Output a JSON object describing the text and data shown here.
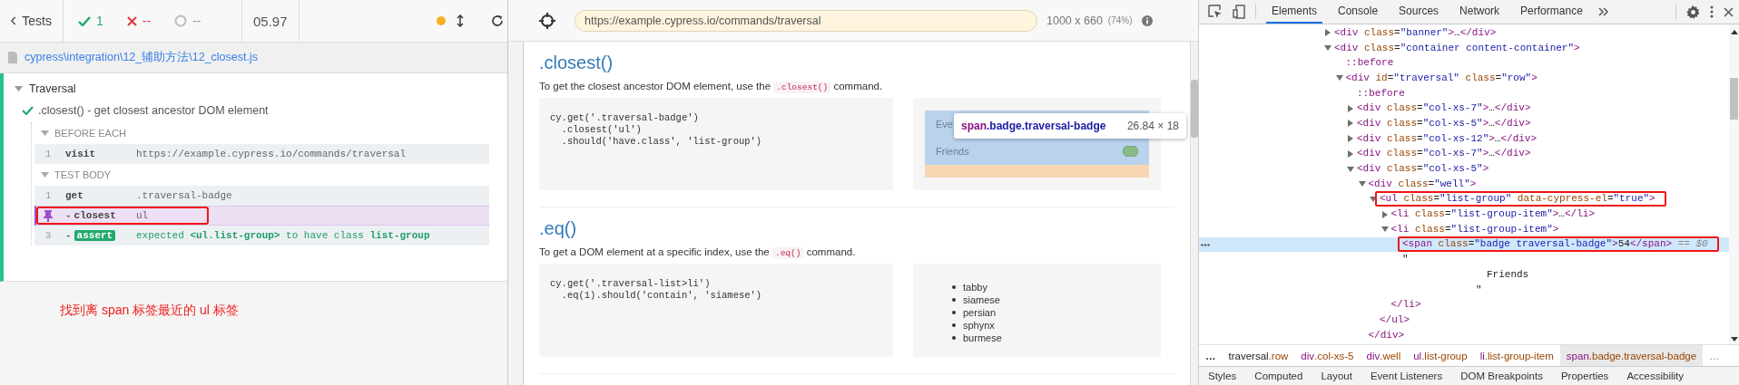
{
  "runner": {
    "back_button": "Tests",
    "stats": {
      "passed": "1",
      "failed": "--",
      "pending": "--",
      "duration": "05.97"
    },
    "spec_file": "cypress\\integration\\12_辅助方法\\12_closest.js",
    "suite": {
      "title": "Traversal",
      "expanded": true,
      "test": {
        "title": ".closest() - get closest ancestor DOM element",
        "passed": true,
        "hooks": [
          {
            "title": "BEFORE EACH",
            "expanded": true,
            "commands": [
              {
                "number": "1",
                "name": "visit",
                "message": "https://example.cypress.io/commands/traversal",
                "kind": "command",
                "pinned": false,
                "boxed": false
              }
            ]
          },
          {
            "title": "TEST BODY",
            "expanded": true,
            "commands": [
              {
                "number": "1",
                "name": "get",
                "message": ".traversal-badge",
                "kind": "command",
                "pinned": false,
                "boxed": false
              },
              {
                "prefix": "-",
                "name": "closest",
                "message": "ul",
                "kind": "command",
                "pinned": true,
                "boxed": true
              },
              {
                "number": "3",
                "prefix": "-",
                "name": "assert",
                "message": "expected **<ul.list-group>** to have class **list-group**",
                "kind": "assert",
                "pinned": false,
                "boxed": false
              }
            ]
          }
        ]
      }
    },
    "annotation": "找到离 span 标签最近的 ul 标签"
  },
  "aut": {
    "url": "https://example.cypress.io/commands/traversal",
    "viewport": "1000 x 660",
    "scale": "(74%)",
    "sections": [
      {
        "title": ".closest()",
        "description": {
          "before": "To get the closest ancestor DOM element, use the",
          "code": ".closest()",
          "after": "command."
        },
        "code": [
          "cy.get('.traversal-badge')",
          "  .closest('ul')",
          "  .should('have.class', 'list-group')"
        ],
        "demo": {
          "kind": "list-group",
          "items": [
            "Eve",
            "Friends"
          ],
          "tooltip": {
            "tag": "span",
            "classes": ".badge.traversal-badge",
            "size": "26.84 × 18"
          }
        }
      },
      {
        "title": ".eq()",
        "description": {
          "before": "To get a DOM element at a specific index, use the",
          "code": ".eq()",
          "after": "command."
        },
        "code": [
          "cy.get('.traversal-list>li')",
          "  .eq(1).should('contain', 'siamese')"
        ],
        "demo": {
          "kind": "bullet-list",
          "items": [
            "tabby",
            "siamese",
            "persian",
            "sphynx",
            "burmese"
          ]
        }
      }
    ]
  },
  "devtools": {
    "tabs": [
      {
        "label": "Elements",
        "selected": true
      },
      {
        "label": "Console",
        "selected": false
      },
      {
        "label": "Sources",
        "selected": false
      },
      {
        "label": "Network",
        "selected": false
      },
      {
        "label": "Performance",
        "selected": false
      }
    ],
    "dom_tree": [
      {
        "kind": "element",
        "open": "<div class=\"banner\">…</div>",
        "expanded": false,
        "selected": false,
        "boxed": false
      },
      {
        "kind": "element",
        "open": "<div class=\"container content-container\">",
        "expanded": true,
        "selected": false,
        "boxed": false,
        "children": [
          {
            "kind": "pseudo",
            "open": "::before",
            "selected": false,
            "boxed": false
          },
          {
            "kind": "element",
            "open": "<div id=\"traversal\" class=\"row\">",
            "expanded": true,
            "selected": false,
            "boxed": false,
            "children": [
              {
                "kind": "pseudo",
                "open": "::before",
                "selected": false,
                "boxed": false
              },
              {
                "kind": "element",
                "open": "<div class=\"col-xs-7\">…</div>",
                "expanded": false,
                "selected": false,
                "boxed": false
              },
              {
                "kind": "element",
                "open": "<div class=\"col-xs-5\">…</div>",
                "expanded": false,
                "selected": false,
                "boxed": false
              },
              {
                "kind": "element",
                "open": "<div class=\"col-xs-12\">…</div>",
                "expanded": false,
                "selected": false,
                "boxed": false
              },
              {
                "kind": "element",
                "open": "<div class=\"col-xs-7\">…</div>",
                "expanded": false,
                "selected": false,
                "boxed": false
              },
              {
                "kind": "element",
                "open": "<div class=\"col-xs-5\">",
                "expanded": true,
                "selected": false,
                "boxed": false,
                "children": [
                  {
                    "kind": "element",
                    "open": "<div class=\"well\">",
                    "expanded": true,
                    "selected": false,
                    "boxed": false,
                    "close": "</div>",
                    "children": [
                      {
                        "kind": "element",
                        "open": "<ul class=\"list-group\" data-cypress-el=\"true\">",
                        "expanded": true,
                        "selected": false,
                        "boxed": true,
                        "close": "</ul>",
                        "children": [
                          {
                            "kind": "element",
                            "open": "<li class=\"list-group-item\">…</li>",
                            "expanded": false,
                            "selected": false,
                            "boxed": false
                          },
                          {
                            "kind": "element",
                            "open": "<li class=\"list-group-item\">",
                            "expanded": true,
                            "selected": false,
                            "boxed": false,
                            "close": "</li>",
                            "children": [
                              {
                                "kind": "leaf",
                                "open": "<span class=\"badge traversal-badge\">54</span>",
                                "marker": "== $0",
                                "selected": true,
                                "boxed": true
                              },
                              {
                                "kind": "text",
                                "lines": [
                                  "\"",
                                  "Friends",
                                  "\""
                                ],
                                "selected": false,
                                "boxed": false
                              }
                            ]
                          }
                        ]
                      }
                    ]
                  }
                ]
              }
            ]
          }
        ]
      }
    ],
    "breadcrumbs": [
      {
        "kind": "overflow",
        "label": "…"
      },
      {
        "kind": "crumb",
        "tag": "traversal",
        "classes": ".row",
        "selected": false
      },
      {
        "kind": "crumb",
        "tag": "div",
        "classes": ".col-xs-5",
        "selected": false
      },
      {
        "kind": "crumb",
        "tag": "div",
        "classes": ".well",
        "selected": false
      },
      {
        "kind": "crumb",
        "tag": "ul",
        "classes": ".list-group",
        "selected": false
      },
      {
        "kind": "crumb",
        "tag": "li",
        "classes": ".list-group-item",
        "selected": false
      },
      {
        "kind": "crumb",
        "tag": "span",
        "classes": ".badge.traversal-badge",
        "selected": true
      },
      {
        "kind": "overflow",
        "label": "…"
      }
    ],
    "panel_tabs": [
      "Styles",
      "Computed",
      "Layout",
      "Event Listeners",
      "DOM Breakpoints",
      "Properties",
      "Accessibility"
    ]
  }
}
